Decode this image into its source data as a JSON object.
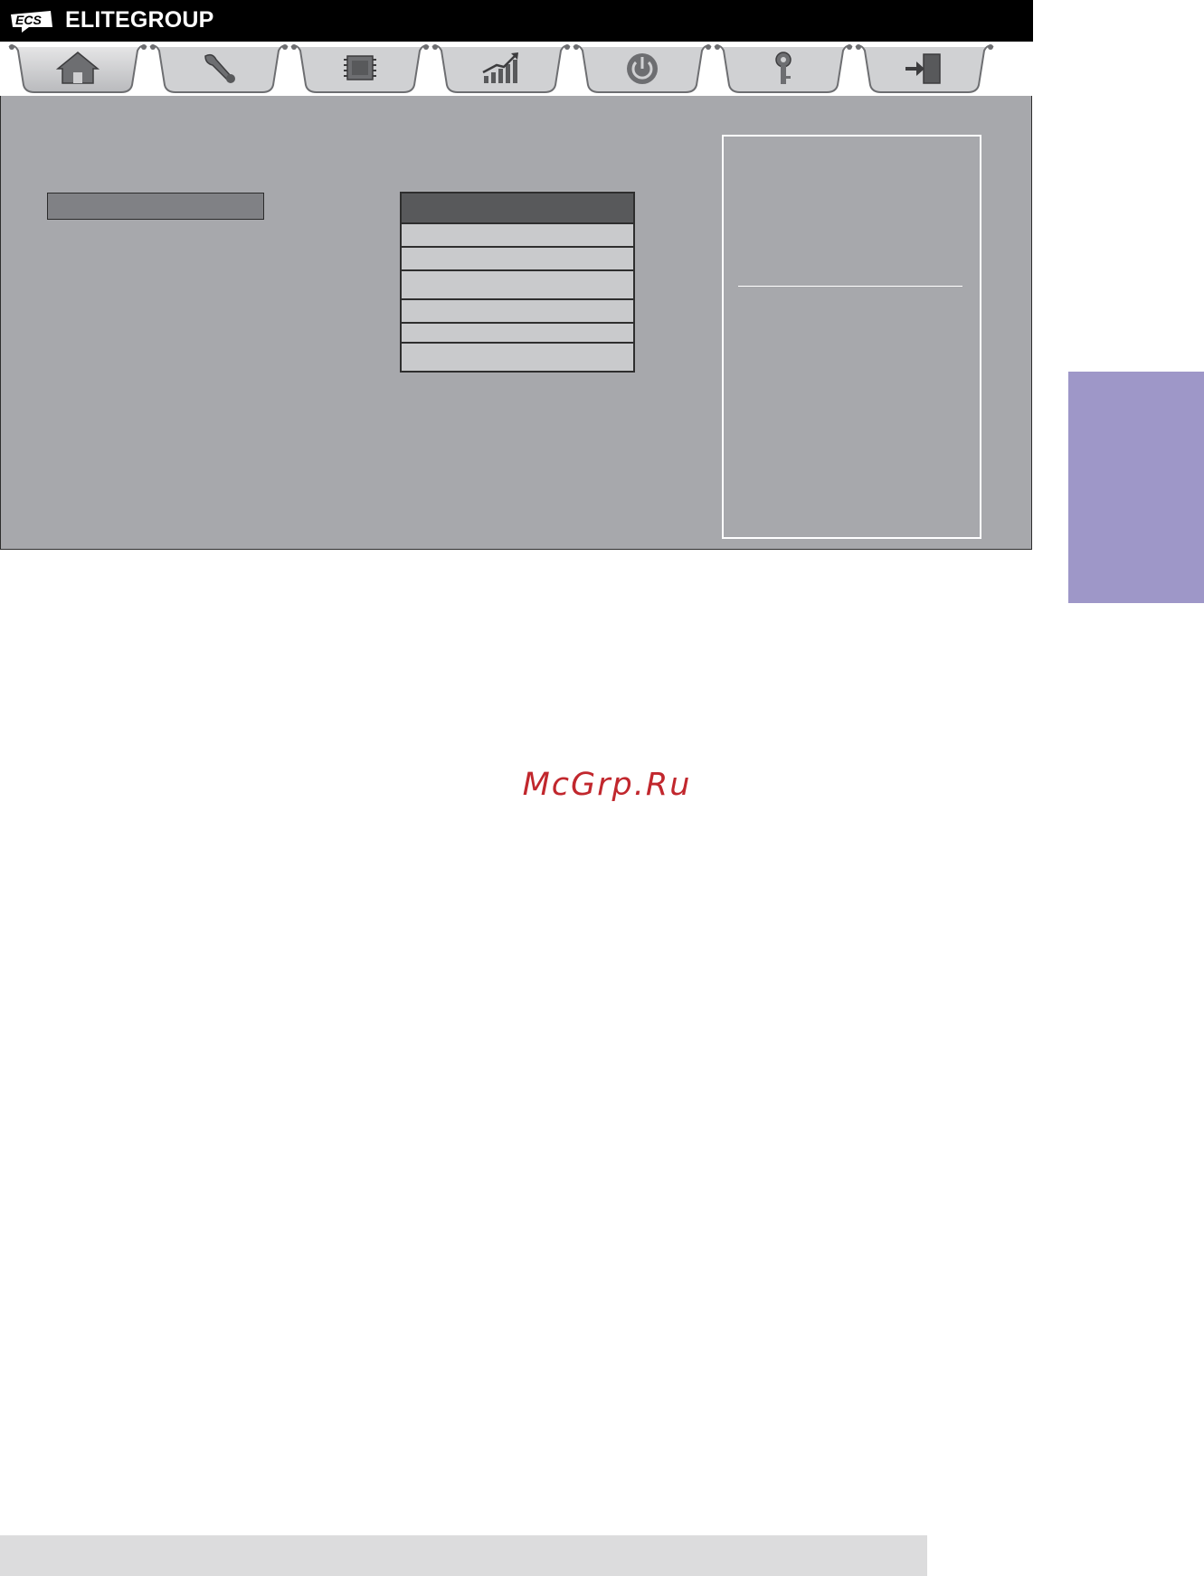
{
  "brand": {
    "logo_text": "ECS",
    "name": "ELITEGROUP"
  },
  "tabs": [
    {
      "icon": "home-icon"
    },
    {
      "icon": "wrench-icon"
    },
    {
      "icon": "chip-icon"
    },
    {
      "icon": "chart-icon"
    },
    {
      "icon": "power-icon"
    },
    {
      "icon": "key-icon"
    },
    {
      "icon": "exit-icon"
    }
  ],
  "main": {
    "selected_field": "",
    "options": [
      "",
      "",
      "",
      "",
      "",
      "",
      ""
    ]
  },
  "help": {
    "text": ""
  },
  "watermark": "McGrp.Ru",
  "colors": {
    "brand_bar": "#000000",
    "panel": "#a7a8ac",
    "option_head": "#58595b",
    "option_row": "#c9cacc",
    "side_tab": "#9e97c8",
    "watermark": "#c1272d"
  }
}
